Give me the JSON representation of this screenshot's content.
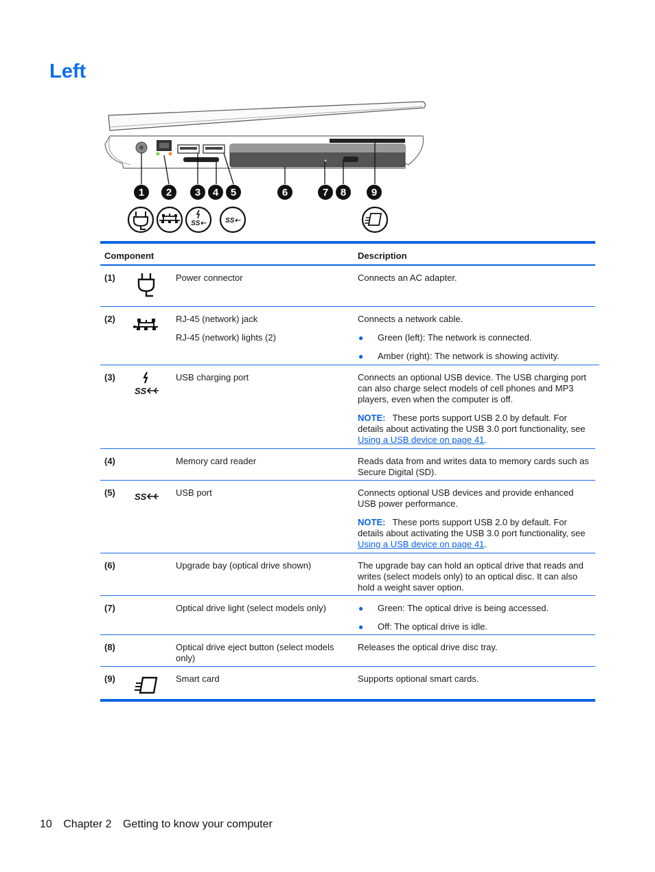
{
  "page": {
    "title": "Left",
    "footer": {
      "page_number": "10",
      "chapter": "Chapter 2",
      "chapter_title": "Getting to know your computer"
    }
  },
  "figure": {
    "callouts": [
      "1",
      "2",
      "3",
      "4",
      "5",
      "6",
      "7",
      "8",
      "9"
    ],
    "icons": [
      "power-plug-icon",
      "network-icon",
      "usb-charging-icon",
      "usb-superspeed-icon",
      "smart-card-icon"
    ]
  },
  "table": {
    "headers": {
      "component": "Component",
      "description": "Description"
    },
    "note_label": "NOTE:",
    "rows": [
      {
        "num": "(1)",
        "icon": "power-plug-icon",
        "component": [
          "Power connector"
        ],
        "description": [
          "Connects an AC adapter."
        ]
      },
      {
        "num": "(2)",
        "icon": "network-icon",
        "component": [
          "RJ-45 (network) jack",
          "RJ-45 (network) lights (2)"
        ],
        "description": [
          "Connects a network cable."
        ],
        "bullets": [
          "Green (left): The network is connected.",
          "Amber (right): The network is showing activity."
        ]
      },
      {
        "num": "(3)",
        "icon": "usb-charging-icon",
        "component": [
          "USB charging port"
        ],
        "description": [
          "Connects an optional USB device. The USB charging port can also charge select models of cell phones and MP3 players, even when the computer is off."
        ],
        "note": {
          "text": "These ports support USB 2.0 by default. For details about activating the USB 3.0 port functionality, see ",
          "link": "Using a USB device on page 41",
          "after": "."
        }
      },
      {
        "num": "(4)",
        "icon": "",
        "component": [
          "Memory card reader"
        ],
        "description": [
          "Reads data from and writes data to memory cards such as Secure Digital (SD)."
        ]
      },
      {
        "num": "(5)",
        "icon": "usb-superspeed-icon",
        "component": [
          "USB port"
        ],
        "description": [
          "Connects optional USB devices and provide enhanced USB power performance."
        ],
        "note": {
          "text": "These ports support USB 2.0 by default. For details about activating the USB 3.0 port functionality, see ",
          "link": "Using a USB device on page 41",
          "after": "."
        }
      },
      {
        "num": "(6)",
        "icon": "",
        "component": [
          "Upgrade bay (optical drive shown)"
        ],
        "description": [
          "The upgrade bay can hold an optical drive that reads and writes (select models only) to an optical disc. It can also hold a weight saver option."
        ]
      },
      {
        "num": "(7)",
        "icon": "",
        "component": [
          "Optical drive light (select models only)"
        ],
        "bullets": [
          "Green: The optical drive is being accessed.",
          "Off: The optical drive is idle."
        ]
      },
      {
        "num": "(8)",
        "icon": "",
        "component": [
          "Optical drive eject button (select models only)"
        ],
        "description": [
          "Releases the optical drive disc tray."
        ]
      },
      {
        "num": "(9)",
        "icon": "smart-card-icon",
        "component": [
          "Smart card"
        ],
        "description": [
          "Supports optional smart cards."
        ]
      }
    ]
  },
  "colors": {
    "accent": "#0a62e0",
    "title": "#0d6ef0"
  }
}
